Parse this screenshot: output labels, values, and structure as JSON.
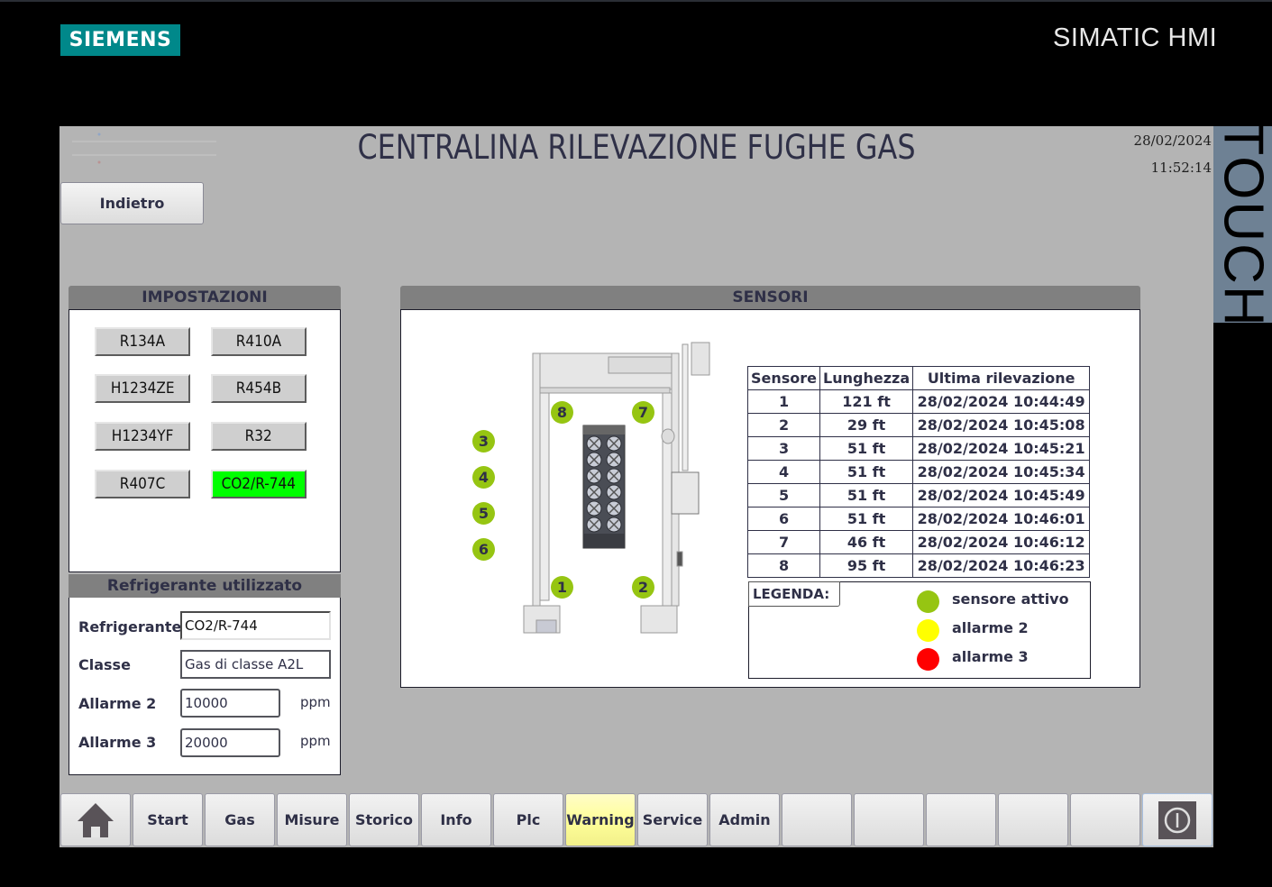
{
  "header": {
    "logo": "SIEMENS",
    "brand": "SIMATIC HMI",
    "side_label": "TOUCH"
  },
  "screen": {
    "title": "CENTRALINA RILEVAZIONE FUGHE GAS",
    "date": "28/02/2024",
    "time": "11:52:14",
    "back_label": "Indietro"
  },
  "settings": {
    "title": "IMPOSTAZIONI",
    "refrigerants": [
      {
        "label": "R134A",
        "active": false
      },
      {
        "label": "R410A",
        "active": false
      },
      {
        "label": "H1234ZE",
        "active": false
      },
      {
        "label": "R454B",
        "active": false
      },
      {
        "label": "H1234YF",
        "active": false
      },
      {
        "label": "R32",
        "active": false
      },
      {
        "label": "R407C",
        "active": false
      },
      {
        "label": "CO2/R-744",
        "active": true
      }
    ],
    "active_color": "#00ff00"
  },
  "used": {
    "title": "Refrigerante utilizzato",
    "refrigerant_label": "Refrigerante",
    "refrigerant_value": "CO2/R-744",
    "class_label": "Classe",
    "class_value": "Gas di classe A2L",
    "alarm2_label": "Allarme 2",
    "alarm2_value": "10000",
    "alarm3_label": "Allarme 3",
    "alarm3_value": "20000",
    "unit": "ppm"
  },
  "sensors": {
    "title": "SENSORI",
    "markers": [
      "1",
      "2",
      "3",
      "4",
      "5",
      "6",
      "7",
      "8"
    ],
    "marker_color": "#96c512",
    "table": {
      "headers": [
        "Sensore",
        "Lunghezza",
        "Ultima rilevazione"
      ],
      "rows": [
        [
          "1",
          "121 ft",
          "28/02/2024 10:44:49"
        ],
        [
          "2",
          "29 ft",
          "28/02/2024 10:45:08"
        ],
        [
          "3",
          "51 ft",
          "28/02/2024 10:45:21"
        ],
        [
          "4",
          "51 ft",
          "28/02/2024 10:45:34"
        ],
        [
          "5",
          "51 ft",
          "28/02/2024 10:45:49"
        ],
        [
          "6",
          "51 ft",
          "28/02/2024 10:46:01"
        ],
        [
          "7",
          "46 ft",
          "28/02/2024 10:46:12"
        ],
        [
          "8",
          "95 ft",
          "28/02/2024 10:46:23"
        ]
      ]
    },
    "legend": {
      "title": "LEGENDA:",
      "items": [
        {
          "label": "sensore attivo",
          "color": "#96c512"
        },
        {
          "label": "allarme 2",
          "color": "#ffff00"
        },
        {
          "label": "allarme 3",
          "color": "#ff0000"
        }
      ]
    }
  },
  "navbar": {
    "items": [
      {
        "label": "",
        "icon": "home-icon"
      },
      {
        "label": "Start"
      },
      {
        "label": "Gas"
      },
      {
        "label": "Misure"
      },
      {
        "label": "Storico"
      },
      {
        "label": "Info"
      },
      {
        "label": "Plc"
      },
      {
        "label": "Warning",
        "highlight": true
      },
      {
        "label": "Service"
      },
      {
        "label": "Admin"
      },
      {
        "label": ""
      },
      {
        "label": ""
      },
      {
        "label": ""
      },
      {
        "label": ""
      },
      {
        "label": ""
      },
      {
        "label": "",
        "icon": "power-icon"
      }
    ]
  }
}
